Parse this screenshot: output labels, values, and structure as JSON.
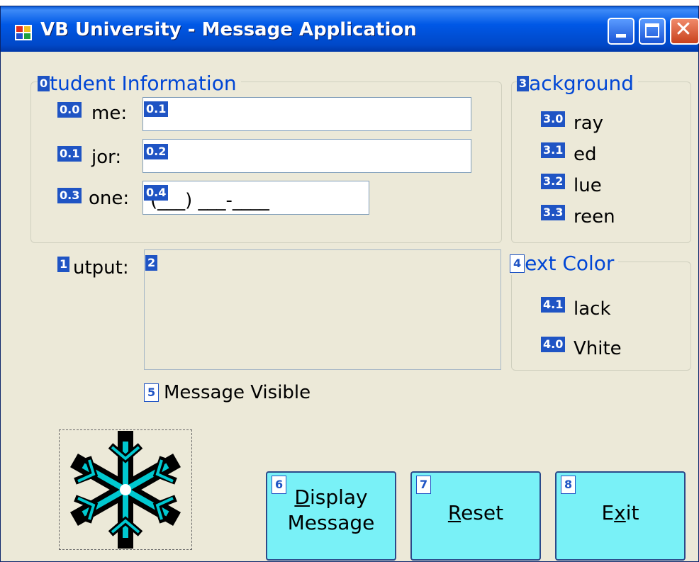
{
  "window": {
    "title": "VB University - Message Application",
    "colors": {
      "titlebar": "#0058e6",
      "face": "#ece9d8",
      "group_text": "#0046d5",
      "button_face": "#79f1f7"
    }
  },
  "student_group": {
    "tag": "0",
    "title": "tudent Information",
    "fields": [
      {
        "label_tag": "0.0",
        "label": "me:",
        "input_tag": "0.1",
        "value": ""
      },
      {
        "label_tag": "0.1",
        "label": "jor:",
        "input_tag": "0.2",
        "value": ""
      },
      {
        "label_tag": "0.3",
        "label": "one:",
        "input_tag": "0.4",
        "value": "(___) ___-____"
      }
    ]
  },
  "background_group": {
    "tag": "3",
    "title": "ackground",
    "options": [
      {
        "tag": "3.0",
        "label": "ray"
      },
      {
        "tag": "3.1",
        "label": "ed"
      },
      {
        "tag": "3.2",
        "label": "lue"
      },
      {
        "tag": "3.3",
        "label": "reen"
      }
    ]
  },
  "output": {
    "label_tag": "1",
    "label": "utput:",
    "box_tag": "2",
    "value": ""
  },
  "textcolor_group": {
    "tag": "4",
    "title": "ext Color",
    "options": [
      {
        "tag": "4.1",
        "label": "lack"
      },
      {
        "tag": "4.0",
        "label": "Vhite"
      }
    ]
  },
  "message_visible": {
    "tag": "5",
    "label": "Message Visible"
  },
  "buttons": {
    "display": {
      "tag": "6",
      "mnemonic": "D",
      "line1_rest": "isplay",
      "line2": "Message"
    },
    "reset": {
      "tag": "7",
      "mnemonic": "R",
      "rest": "eset"
    },
    "exit": {
      "tag": "8",
      "before": "E",
      "mnemonic": "x",
      "after": "it"
    }
  },
  "picture": {
    "icon": "snowflake-icon"
  }
}
